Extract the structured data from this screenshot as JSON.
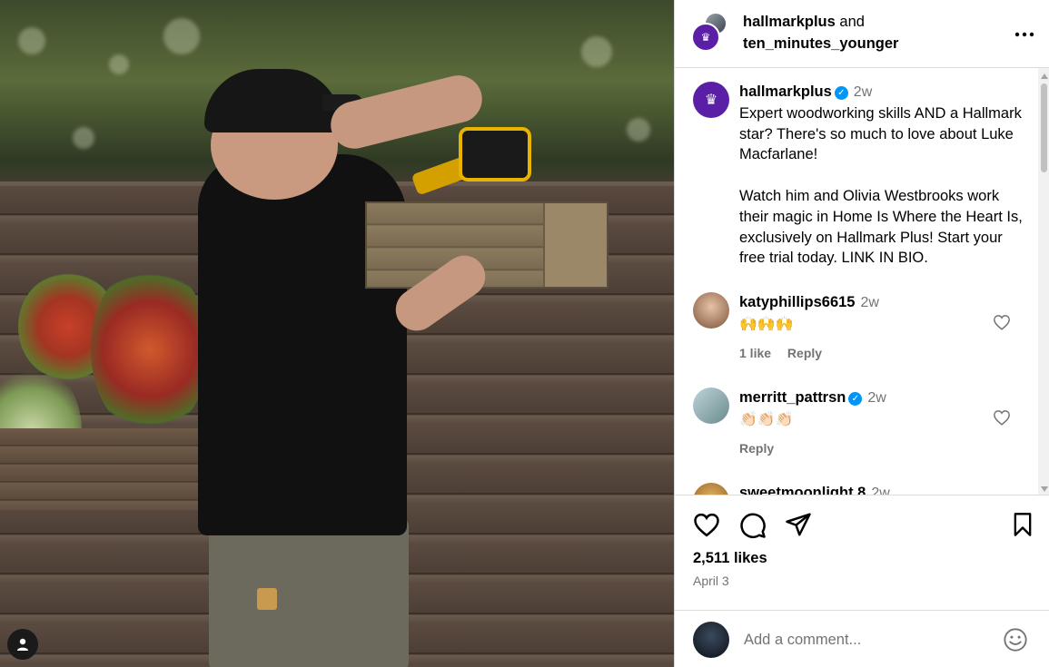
{
  "header": {
    "user1": "hallmarkplus",
    "and_text": "and",
    "user2": "ten_minutes_younger",
    "more_icon": "more-horizontal-icon"
  },
  "caption": {
    "username": "hallmarkplus",
    "time": "2w",
    "text": "Expert woodworking skills AND a Hallmark star? There's so much to love about Luke Macfarlane!\n\nWatch him and Olivia Westbrooks work their magic in Home Is Where the Heart Is, exclusively on Hallmark Plus! Start your free trial today. LINK IN BIO."
  },
  "comments": [
    {
      "username": "katyphillips6615",
      "time": "2w",
      "text": "🙌🙌🙌",
      "likes": "1 like",
      "reply": "Reply",
      "verified": false
    },
    {
      "username": "merritt_pattrsn",
      "time": "2w",
      "text": "👏🏻👏🏻👏🏻",
      "likes": "",
      "reply": "Reply",
      "verified": true
    },
    {
      "username": "sweetmoonlight.8",
      "time": "2w",
      "text": "",
      "likes": "",
      "reply": "",
      "verified": false
    }
  ],
  "actions": {
    "likes": "2,511 likes",
    "date": "April 3"
  },
  "comment_box": {
    "placeholder": "Add a comment..."
  },
  "colors": {
    "brand_purple": "#5a1fa6",
    "verified_blue": "#0095f6",
    "muted": "#737373"
  }
}
